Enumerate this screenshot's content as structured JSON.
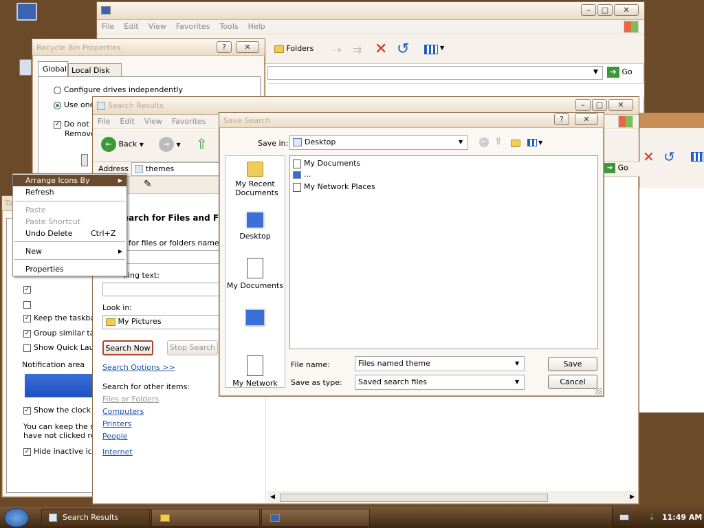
{
  "explorer": {
    "menu": [
      "File",
      "Edit",
      "View",
      "Favorites",
      "Tools",
      "Help"
    ],
    "folders_label": "Folders",
    "go_label": "Go"
  },
  "recycle": {
    "title": "Recycle Bin Properties",
    "tabs": [
      "Global",
      "Local Disk (C:)"
    ],
    "opt_independent": "Configure drives independently",
    "opt_use_one": "Use one",
    "do_not_move": "Do not m",
    "remove": "Remove"
  },
  "taskbar_props": {
    "tab_letters": "Ta",
    "keep_taskbar": "Keep the taskbar",
    "group_similar": "Group similar task",
    "show_quick": "Show Quick Laun",
    "notification_area": "Notification area",
    "show_clock": "Show the clock",
    "keep_text_1": "You can keep the no",
    "keep_text_2": "have not clicked rece",
    "hide_inactive": "Hide inactive icon"
  },
  "context_menu": {
    "arrange": "Arrange Icons By",
    "refresh": "Refresh",
    "paste": "Paste",
    "paste_shortcut": "Paste Shortcut",
    "undo_delete": "Undo Delete",
    "undo_shortcut": "Ctrl+Z",
    "new": "New",
    "properties": "Properties"
  },
  "search": {
    "title": "Search Results",
    "menu": [
      "File",
      "Edit",
      "View",
      "Favorites"
    ],
    "back": "Back",
    "address_label": "Address",
    "address_value": "themes",
    "heading": "earch for Files and Folde",
    "named_label": "for files or folders named:",
    "containing_label": "ning text:",
    "look_in_label": "Look in:",
    "look_in_value": "My Pictures",
    "search_now": "Search Now",
    "stop_search": "Stop Search",
    "search_options": "Search Options >>",
    "other_items": "Search for other items:",
    "links": [
      "Files or Folders",
      "Computers",
      "Printers",
      "People"
    ],
    "internet": "Internet",
    "go_label": "Go"
  },
  "save_dialog": {
    "title": "Save Search",
    "help": "?",
    "close": "✕",
    "save_in_label": "Save in:",
    "save_in_value": "Desktop",
    "places": [
      "My Recent Documents",
      "Desktop",
      "My Documents",
      "",
      "My Network"
    ],
    "files": [
      "My Documents",
      "...",
      "My Network Places"
    ],
    "file_name_label": "File name:",
    "file_name_value": "Files named theme",
    "save_type_label": "Save as type:",
    "save_type_value": "Saved search files",
    "save_btn": "Save",
    "cancel_btn": "Cancel"
  },
  "taskbar": {
    "task_search": "Search Results",
    "clock": "11:49 AM"
  }
}
